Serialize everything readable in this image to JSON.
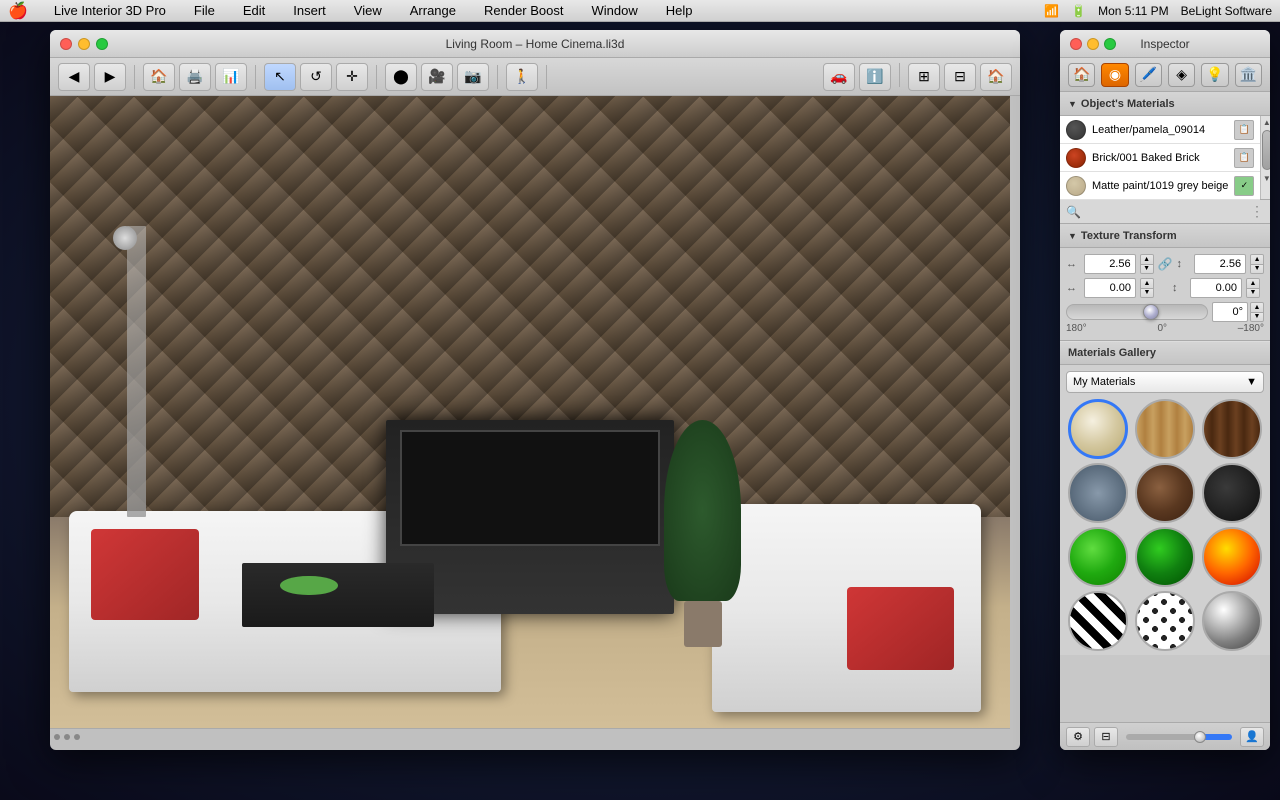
{
  "menubar": {
    "apple": "🍎",
    "items": [
      "Live Interior 3D Pro",
      "File",
      "Edit",
      "Insert",
      "View",
      "Arrange",
      "Render Boost",
      "Window",
      "Help"
    ],
    "right": {
      "time": "Mon 5:11 PM",
      "brand": "BeLight Software"
    }
  },
  "main_window": {
    "title": "Living Room – Home Cinema.li3d",
    "traffic_lights": [
      "red",
      "yellow",
      "green"
    ]
  },
  "inspector": {
    "title": "Inspector",
    "traffic_lights": [
      "red",
      "yellow",
      "green"
    ],
    "tabs": [
      "house-icon",
      "material-icon",
      "paint-icon",
      "texture-icon",
      "light-icon",
      "building-icon"
    ],
    "objects_materials": {
      "label": "Object's Materials",
      "materials": [
        {
          "name": "Leather/pamela_09014",
          "color": "#5a5a5a",
          "selected": false
        },
        {
          "name": "Brick/001 Baked Brick",
          "color": "#cc4422",
          "selected": false
        },
        {
          "name": "Matte paint/1019 grey beige",
          "color": "#d4c8a8",
          "selected": false
        }
      ]
    },
    "texture_transform": {
      "label": "Texture Transform",
      "width_value": "2.56",
      "height_value": "2.56",
      "offset_x": "0.00",
      "offset_y": "0.00",
      "rotation": "0°",
      "rotation_min": "180°",
      "rotation_mid": "0°",
      "rotation_max": "–180°"
    },
    "materials_gallery": {
      "label": "Materials Gallery",
      "dropdown_value": "My Materials",
      "materials": [
        {
          "id": "cream",
          "class": "mat-cream"
        },
        {
          "id": "wood-light",
          "class": "mat-wood-light"
        },
        {
          "id": "wood-dark-brown",
          "class": "mat-wood-dark"
        },
        {
          "id": "stone-blue",
          "class": "mat-stone"
        },
        {
          "id": "brown-marble",
          "class": "mat-brown-marble"
        },
        {
          "id": "dark",
          "class": "mat-dark"
        },
        {
          "id": "green-bright",
          "class": "mat-green-bright"
        },
        {
          "id": "green-dark",
          "class": "mat-green-dark"
        },
        {
          "id": "fire",
          "class": "mat-fire"
        },
        {
          "id": "zebra",
          "class": "mat-zebra"
        },
        {
          "id": "spots",
          "class": "mat-spots"
        },
        {
          "id": "chrome",
          "class": "mat-chrome"
        }
      ]
    }
  },
  "toolbar": {
    "buttons": [
      "back",
      "forward",
      "floorplan",
      "render",
      "3dview",
      "select",
      "rotate",
      "move",
      "circle",
      "camera-top",
      "camera-front",
      "camera-3d",
      "info",
      "fullscreen",
      "home",
      "rotate3d"
    ],
    "right_buttons": [
      "car-icon",
      "info-icon",
      "fullscreen-icon",
      "layout-icon",
      "house-icon",
      "scene-icon"
    ]
  }
}
